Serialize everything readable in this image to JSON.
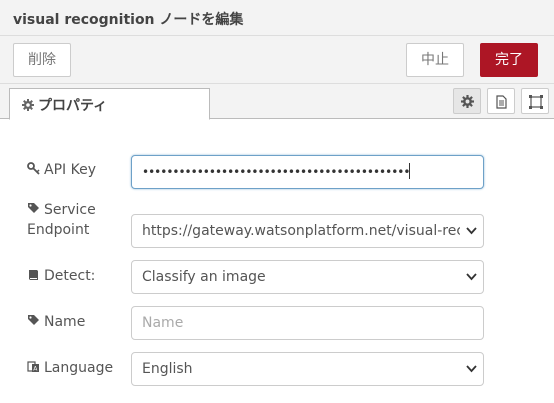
{
  "title": "visual recognition ノードを編集",
  "toolbar": {
    "delete_label": "削除",
    "cancel_label": "中止",
    "done_label": "完了"
  },
  "tabs": {
    "properties_label": "プロパティ"
  },
  "fields": {
    "api_key": {
      "label": "API Key",
      "value": "••••••••••••••••••••••••••••••••••••••••••••"
    },
    "service_endpoint": {
      "label_line1": "Service",
      "label_line2": "Endpoint",
      "value": "https://gateway.watsonplatform.net/visual-recognition/api"
    },
    "detect": {
      "label": "Detect:",
      "value": "Classify an image"
    },
    "name": {
      "label": "Name",
      "placeholder": "Name",
      "value": ""
    },
    "language": {
      "label": "Language",
      "value": "English"
    }
  },
  "colors": {
    "accent": "#ad1625",
    "focus_border": "#6ea1c8",
    "panel_bg": "#f3f3f3"
  },
  "icons": [
    "gear-icon",
    "description-icon",
    "appearance-icon",
    "key-icon",
    "tag-icon",
    "book-icon",
    "language-icon",
    "chevron-down-icon"
  ]
}
